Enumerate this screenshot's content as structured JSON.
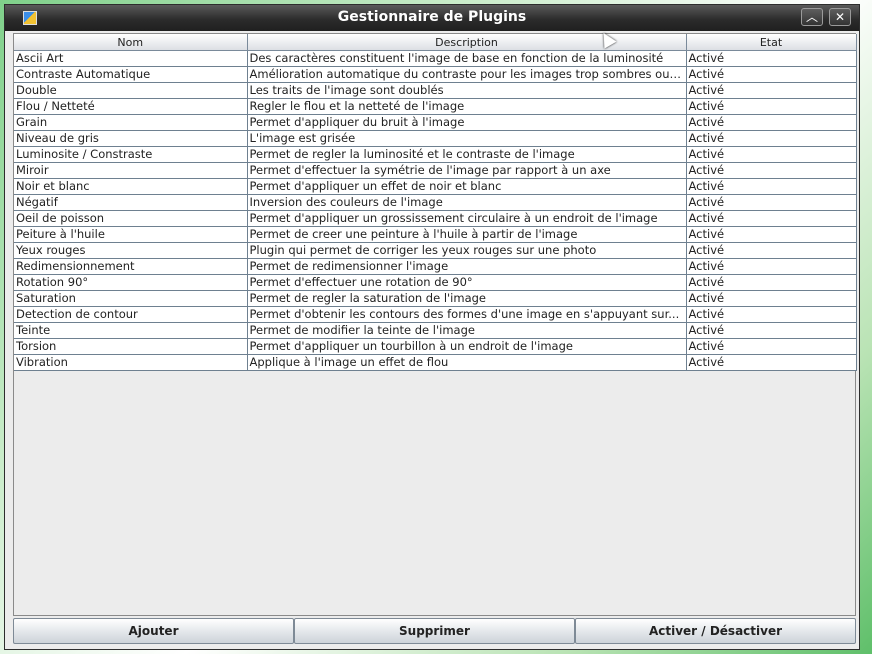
{
  "window": {
    "title": "Gestionnaire de Plugins"
  },
  "table": {
    "headers": [
      "Nom",
      "Description",
      "Etat"
    ],
    "rows": [
      [
        "Ascii Art",
        "Des caractères constituent l'image de base en fonction de la luminosité",
        "Activé"
      ],
      [
        "Contraste Automatique",
        "Amélioration automatique du contraste pour les images trop sombres ou ...",
        "Activé"
      ],
      [
        "Double",
        "Les traits de l'image sont doublés",
        "Activé"
      ],
      [
        "Flou / Netteté",
        "Regler le flou et la netteté de l'image",
        "Activé"
      ],
      [
        "Grain",
        "Permet d'appliquer du bruit à l'image",
        "Activé"
      ],
      [
        "Niveau de gris",
        "L'image est grisée",
        "Activé"
      ],
      [
        "Luminosite / Constraste",
        "Permet de regler la luminosité et le contraste de l'image",
        "Activé"
      ],
      [
        "Miroir",
        "Permet d'effectuer la symétrie de l'image par rapport à un axe",
        "Activé"
      ],
      [
        "Noir et blanc",
        "Permet d'appliquer un effet de noir et blanc",
        "Activé"
      ],
      [
        "Négatif",
        "Inversion des couleurs de l'image",
        "Activé"
      ],
      [
        "Oeil de poisson",
        "Permet d'appliquer un grossissement circulaire à un endroit de l'image",
        "Activé"
      ],
      [
        "Peiture à l'huile",
        "Permet de creer une peinture à l'huile à partir de l'image",
        "Activé"
      ],
      [
        "Yeux rouges",
        "Plugin qui permet de corriger les yeux rouges sur une photo",
        "Activé"
      ],
      [
        "Redimensionnement",
        "Permet de redimensionner l'image",
        "Activé"
      ],
      [
        "Rotation 90°",
        "Permet d'effectuer une rotation de 90°",
        "Activé"
      ],
      [
        "Saturation",
        "Permet de regler la saturation de l'image",
        "Activé"
      ],
      [
        "Detection de contour",
        "Permet d'obtenir les contours des formes d'une image en s'appuyant sur...",
        "Activé"
      ],
      [
        "Teinte",
        "Permet de modifier la teinte de l'image",
        "Activé"
      ],
      [
        "Torsion",
        "Permet d'appliquer un tourbillon à un endroit de l'image",
        "Activé"
      ],
      [
        "Vibration",
        "Applique à l'image un effet de flou",
        "Activé"
      ]
    ]
  },
  "buttons": {
    "add": "Ajouter",
    "remove": "Supprimer",
    "toggle": "Activer / Désactiver"
  },
  "icons": {
    "app": "plugin-app-icon",
    "maximize": "chevron-up-icon",
    "close": "close-icon",
    "cursor": "mouse-pointer-icon"
  }
}
